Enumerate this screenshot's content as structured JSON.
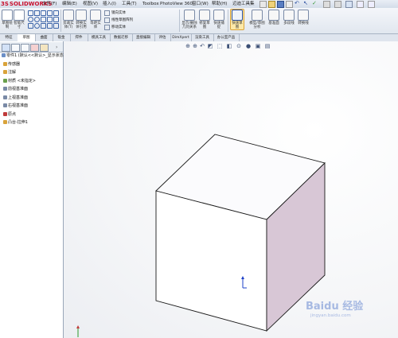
{
  "app": {
    "logo_text": "SOLIDWORKS",
    "logo_prefix": "3S"
  },
  "menu": [
    "文件(F)",
    "编辑(E)",
    "视图(V)",
    "插入(I)",
    "工具(T)",
    "Toolbox",
    "PhotoView 360",
    "窗口(W)",
    "帮助(H)",
    "迈迪工具集"
  ],
  "ribbon": {
    "sketch": "草图绘制",
    "smart_dim": "智能尺寸",
    "trim": "剪裁实体(T)",
    "convert": "转换实体引用",
    "offset": "等距实体",
    "mirror": "镜向实体",
    "linear_pattern": "线性草图阵列",
    "move": "移动实体",
    "display_delete": "显示/删除几何关系",
    "repair": "修复草图",
    "quick_snap": "快速捕捉",
    "instant2d": "快速草图",
    "instant3d": "Instant3D",
    "rapid_sketch": "模型/草图分析",
    "ref_geometry": "基准面",
    "sketch_feature": "参考几何体",
    "more1": "多段线",
    "more2": "转换线"
  },
  "tabs": [
    "特征",
    "草图",
    "曲面",
    "钣金",
    "焊件",
    "模具工具",
    "数据迁移",
    "直接编辑",
    "评估",
    "DimXpert",
    "渲染工具",
    "办公室产品"
  ],
  "active_tab_index": 1,
  "feature_tree": [
    {
      "label": "零件1 (默认<<默认>_显示状态",
      "icon": "part-icon",
      "color": "#6b8fc7"
    },
    {
      "label": "传感器",
      "icon": "sensor-icon",
      "color": "#d9a33a"
    },
    {
      "label": "注解",
      "icon": "annotation-icon",
      "color": "#d9a33a"
    },
    {
      "label": "材质 <未指定>",
      "icon": "material-icon",
      "color": "#6aa04c"
    },
    {
      "label": "前视基准面",
      "icon": "plane-icon",
      "color": "#7a8aa6"
    },
    {
      "label": "上视基准面",
      "icon": "plane-icon",
      "color": "#7a8aa6"
    },
    {
      "label": "右视基准面",
      "icon": "plane-icon",
      "color": "#7a8aa6"
    },
    {
      "label": "原点",
      "icon": "origin-icon",
      "color": "#c03a3a"
    },
    {
      "label": "凸台-拉伸1",
      "icon": "extrude-icon",
      "color": "#d9a33a"
    }
  ],
  "watermark": "Baidu 经验",
  "watermark_sub": "jingyan.baidu.com",
  "colors": {
    "cube_front": "#ffffff",
    "cube_top": "#ffffff",
    "cube_side": "#d9c7d5",
    "edge": "#1a1a1a",
    "accent": "#2a4fa0"
  }
}
